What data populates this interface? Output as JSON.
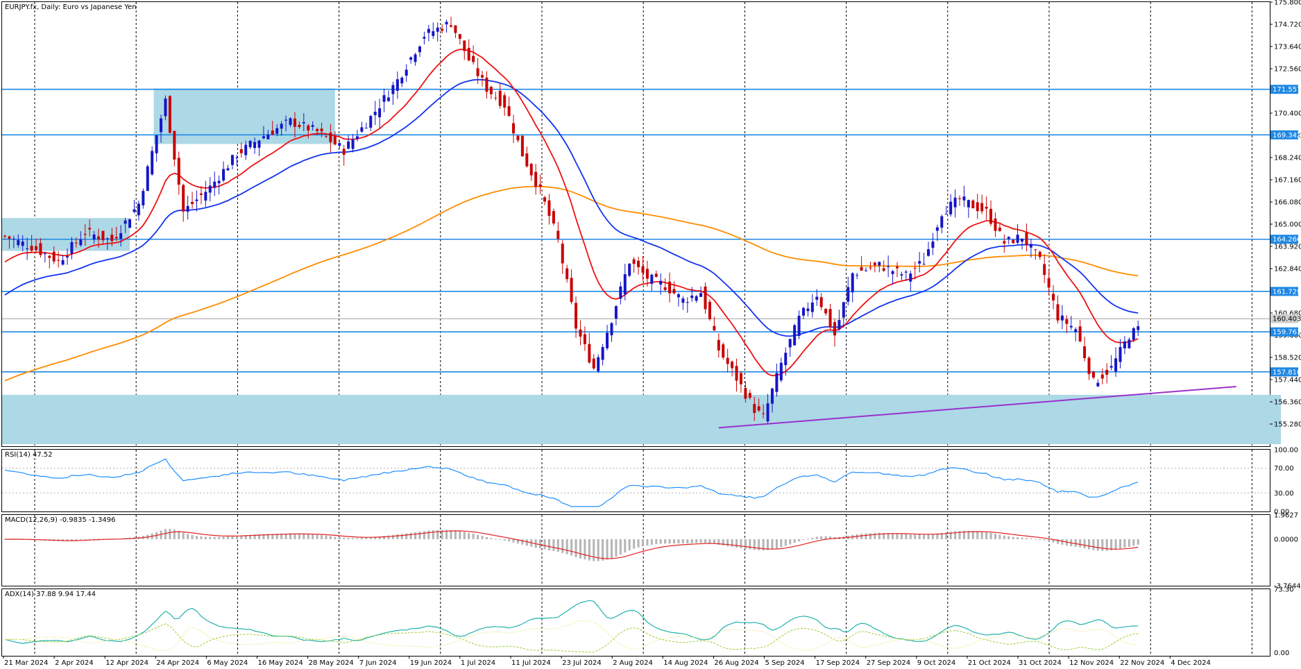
{
  "main_title": "EURJPY.fx, Daily:  Euro vs Japanese Yen",
  "rsi_title": "RSI(14) 47.52",
  "macd_title": "MACD(12,26,9) -0.9835 -1.3496",
  "adx_title": "ADX(14) 37.88 9.94 17.44",
  "colors": {
    "bull": "#1515c8",
    "bear": "#c80000",
    "ma_fast": "#ee1111",
    "ma_mid": "#1133ee",
    "ma_slow": "#ff8c00",
    "sr_line": "#1e88e5",
    "zone": "#add8e6",
    "trend": "#9932cc",
    "rsi": "#1e90ff",
    "macd_hist": "#b4b4b4",
    "macd_signal": "#e02020",
    "adx": "#20b2aa",
    "di_plus": "#9acd32",
    "di_minus": "#f0e68c"
  },
  "chart_data": [
    {
      "type": "candlestick",
      "title": "EURJPY.fx, Daily:  Euro vs Japanese Yen",
      "ylim": [
        154.2,
        175.8
      ],
      "y_ticks": [
        "175.800",
        "174.720",
        "173.640",
        "172.560",
        "170.400",
        "169.320",
        "168.240",
        "167.160",
        "166.080",
        "165.000",
        "163.920",
        "162.840",
        "160.680",
        "159.600",
        "158.520",
        "157.440",
        "156.360",
        "155.280"
      ],
      "x_labels": [
        "21 Mar 2024",
        "2 Apr 2024",
        "12 Apr 2024",
        "24 Apr 2024",
        "6 May 2024",
        "16 May 2024",
        "28 May 2024",
        "7 Jun 2024",
        "19 Jun 2024",
        "1 Jul 2024",
        "11 Jul 2024",
        "23 Jul 2024",
        "2 Aug 2024",
        "14 Aug 2024",
        "26 Aug 2024",
        "5 Sep 2024",
        "17 Sep 2024",
        "27 Sep 2024",
        "9 Oct 2024",
        "21 Oct 2024",
        "31 Oct 2024",
        "12 Nov 2024",
        "22 Nov 2024",
        "4 Dec 2024"
      ],
      "close_path": [
        [
          0,
          164.4
        ],
        [
          6,
          163.9
        ],
        [
          12,
          163.2
        ],
        [
          18,
          164.6
        ],
        [
          24,
          164.2
        ],
        [
          30,
          166.0
        ],
        [
          36,
          171.0
        ],
        [
          40,
          165.6
        ],
        [
          46,
          166.8
        ],
        [
          52,
          168.4
        ],
        [
          58,
          169.3
        ],
        [
          64,
          170.0
        ],
        [
          70,
          169.5
        ],
        [
          76,
          168.6
        ],
        [
          82,
          170.2
        ],
        [
          88,
          172.0
        ],
        [
          94,
          174.2
        ],
        [
          100,
          174.8
        ],
        [
          104,
          173.0
        ],
        [
          108,
          171.6
        ],
        [
          112,
          170.8
        ],
        [
          116,
          168.4
        ],
        [
          120,
          166.6
        ],
        [
          124,
          164.2
        ],
        [
          128,
          160.0
        ],
        [
          132,
          158.0
        ],
        [
          136,
          160.4
        ],
        [
          140,
          163.2
        ],
        [
          144,
          162.4
        ],
        [
          148,
          162.0
        ],
        [
          152,
          161.3
        ],
        [
          156,
          161.7
        ],
        [
          160,
          158.9
        ],
        [
          164,
          157.5
        ],
        [
          168,
          156.0
        ],
        [
          170,
          155.6
        ],
        [
          174,
          158.2
        ],
        [
          178,
          160.4
        ],
        [
          182,
          161.6
        ],
        [
          186,
          159.6
        ],
        [
          190,
          162.6
        ],
        [
          196,
          163.0
        ],
        [
          202,
          162.5
        ],
        [
          206,
          163.2
        ],
        [
          210,
          165.6
        ],
        [
          214,
          166.2
        ],
        [
          220,
          165.6
        ],
        [
          224,
          164.1
        ],
        [
          228,
          164.4
        ],
        [
          232,
          163.2
        ],
        [
          236,
          160.5
        ],
        [
          240,
          159.9
        ],
        [
          244,
          157.3
        ],
        [
          248,
          158.0
        ],
        [
          252,
          159.6
        ],
        [
          254,
          159.9
        ]
      ],
      "moving_averages": [
        {
          "name": "MA fast",
          "color": "#ee1111"
        },
        {
          "name": "MA mid",
          "color": "#1133ee"
        },
        {
          "name": "MA slow",
          "color": "#ff8c00"
        }
      ],
      "horizontal_levels": [
        171.557,
        169.342,
        164.266,
        161.729,
        159.761,
        157.816
      ],
      "current_price": 160.403,
      "level_labels": [
        "171.557",
        "169.342",
        "164.266",
        "161.729",
        "159.761",
        "157.816"
      ],
      "current_label": "160.403",
      "zones": [
        {
          "x": [
            0,
            28
          ],
          "y": [
            163.7,
            165.3
          ]
        },
        {
          "x": [
            34,
            74
          ],
          "y": [
            168.9,
            171.6
          ]
        },
        {
          "x": [
            0,
            286
          ],
          "y": [
            154.3,
            156.7
          ]
        }
      ],
      "trendline": {
        "x": [
          160,
          276
        ],
        "y": [
          155.1,
          157.1
        ]
      }
    },
    {
      "type": "line",
      "title": "RSI(14) 47.52",
      "y_ticks": [
        "100.00",
        "70.00",
        "30.00",
        "0.00"
      ],
      "ylim": [
        0,
        100
      ],
      "levels": [
        70,
        30
      ],
      "last_value": 47.52
    },
    {
      "type": "bar",
      "title": "MACD(12,26,9) -0.9835 -1.3496",
      "y_ticks": [
        "1.9627",
        "0.0000",
        "-3.7644"
      ],
      "ylim": [
        -3.7644,
        1.9627
      ],
      "last_macd": -0.9835,
      "last_signal": -1.3496
    },
    {
      "type": "line",
      "title": "ADX(14) 37.88 9.94 17.44",
      "y_ticks": [
        "73.30",
        "0.00"
      ],
      "ylim": [
        0,
        73.3
      ],
      "last_values": [
        37.88,
        9.94,
        17.44
      ]
    }
  ]
}
